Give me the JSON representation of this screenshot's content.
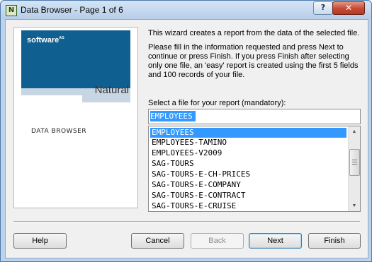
{
  "window": {
    "title": "Data Browser - Page 1 of 6",
    "app_icon_letter": "N",
    "help_glyph": "?",
    "close_glyph": "✕"
  },
  "banner": {
    "brand": "software",
    "brand_suffix": "AG",
    "product": "Natural",
    "section_label": "DATA BROWSER",
    "colors": {
      "brand_blue": "#0f5f90",
      "light_band": "#c7d6e2"
    }
  },
  "description": {
    "line1": "This wizard creates a report from the data of the selected file.",
    "line2": "Please fill in the information requested and press Next to continue or press Finish. If you press Finish after selecting only one file, an 'easy' report is created using the first 5 fields and 100 records of your file."
  },
  "file_select": {
    "label": "Select a file for your report (mandatory):",
    "value": "EMPLOYEES",
    "items": [
      {
        "label": "EMPLOYEES",
        "selected": true
      },
      {
        "label": "EMPLOYEES-TAMINO",
        "selected": false
      },
      {
        "label": "EMPLOYEES-V2009",
        "selected": false
      },
      {
        "label": "SAG-TOURS",
        "selected": false
      },
      {
        "label": "SAG-TOURS-E-CH-PRICES",
        "selected": false
      },
      {
        "label": "SAG-TOURS-E-COMPANY",
        "selected": false
      },
      {
        "label": "SAG-TOURS-E-CONTRACT",
        "selected": false
      },
      {
        "label": "SAG-TOURS-E-CRUISE",
        "selected": false
      }
    ]
  },
  "buttons": {
    "help": "Help",
    "cancel": "Cancel",
    "back": "Back",
    "next": "Next",
    "finish": "Finish"
  },
  "icons": {
    "scroll_up": "▲",
    "scroll_down": "▼"
  }
}
